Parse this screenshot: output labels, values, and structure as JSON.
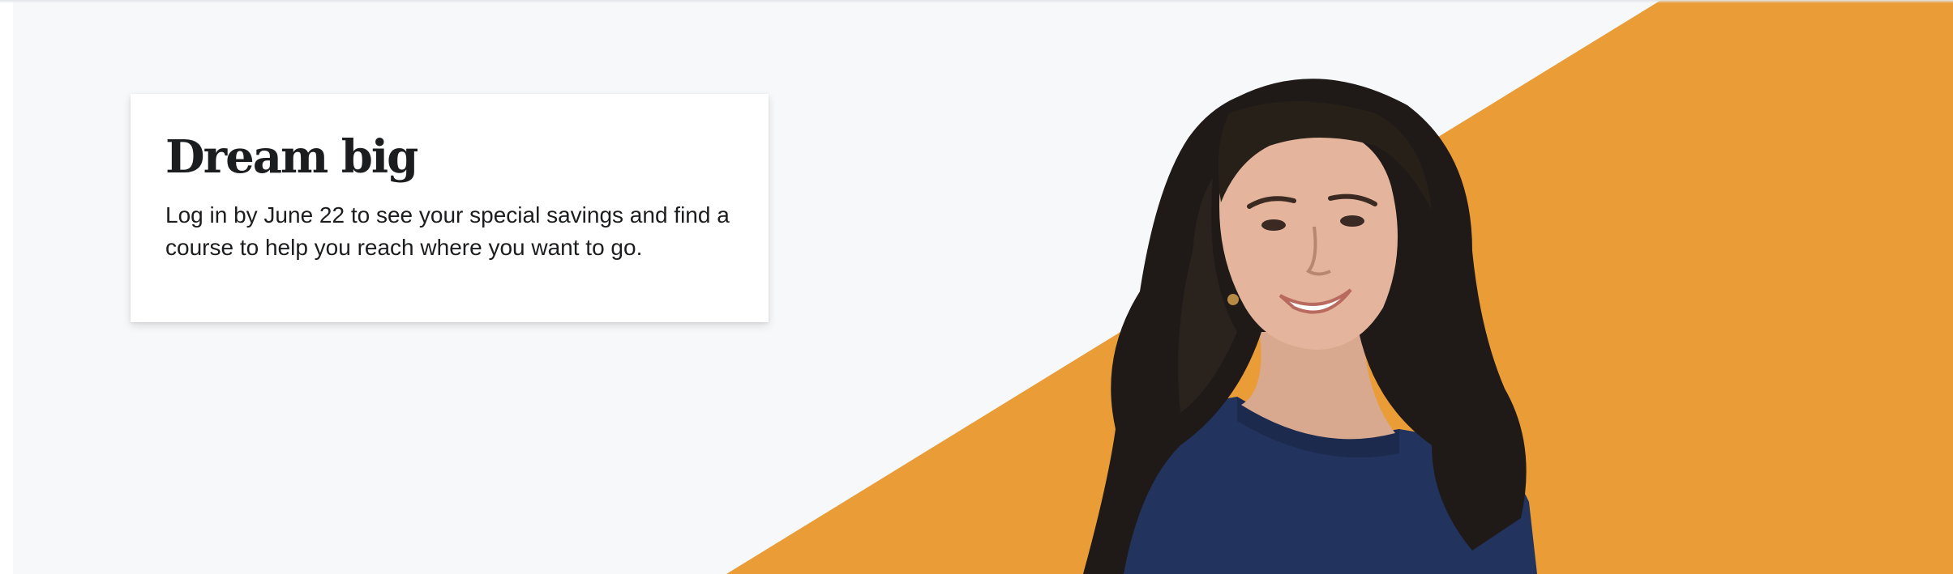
{
  "hero": {
    "title": "Dream big",
    "subtitle": "Log in by June 22 to see your special savings and find a course to help you reach where you want to go.",
    "accent_color": "#ea9c37",
    "background_color": "#f7f8fa"
  },
  "image": {
    "subject": "woman-portrait-illustration"
  }
}
